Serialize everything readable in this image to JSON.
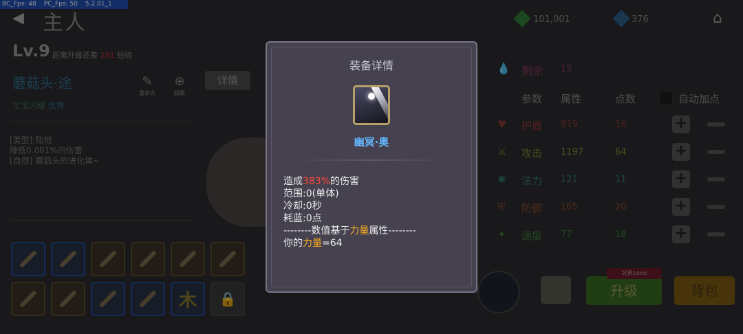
{
  "debug": {
    "bc_fps": "BC_Fps: 48",
    "pc_fps": "PC_Fps: 50",
    "version": "5.2.01_1"
  },
  "header": {
    "back_icon": "back-arrow-icon",
    "title": "主人"
  },
  "currency": {
    "gems_green": "101,001",
    "gems_blue": "376",
    "home_icon": "home-icon"
  },
  "pet": {
    "level": "Lv.9",
    "level_tip_prefix": "距离升级还差",
    "level_tip_value": "281",
    "level_tip_suffix": "经验",
    "name": "蘑菇头·途",
    "quality_label": "宝宝闪耀",
    "quality_value": "优秀",
    "rename_label": "重命名",
    "advance_label": "超级",
    "detail_button": "详情",
    "desc": [
      "[类型]:陆地",
      "降低0.001%的伤害",
      "[自然] 蘑菇头的进化体~"
    ]
  },
  "stats": {
    "remaining_label": "剩余",
    "remaining_value": "15",
    "col_param": "参数",
    "col_attr": "属性",
    "col_points": "点数",
    "auto_add": "自动加点",
    "rows": [
      {
        "label": "护盾",
        "value": "819",
        "points": "16",
        "color": "#8a3a3a",
        "icon": "heart-icon"
      },
      {
        "label": "攻击",
        "value": "1197",
        "points": "64",
        "color": "#8a8a3a",
        "icon": "sword-icon"
      },
      {
        "label": "法力",
        "value": "121",
        "points": "11",
        "color": "#2f7a6a",
        "icon": "magic-icon"
      },
      {
        "label": "防御",
        "value": "165",
        "points": "20",
        "color": "#8a4a2a",
        "icon": "shield-icon"
      },
      {
        "label": "速度",
        "value": "77",
        "points": "18",
        "color": "#3a7a3a",
        "icon": "wing-icon"
      }
    ]
  },
  "actions": {
    "upgrade": "升级",
    "upgrade_cost": "耗费1666",
    "bag": "背包"
  },
  "modal": {
    "title": "装备详情",
    "item_name": "幽冥·奥",
    "line1_a": "造成",
    "line1_b": "383%",
    "line1_c": "的伤害",
    "line2": "范围:0(单体)",
    "line3": "冷却:0秒",
    "line4": "耗蓝:0点",
    "line5_a": "--------数值基于",
    "line5_b": "力量",
    "line5_c": "属性--------",
    "line6_a": "你的",
    "line6_b": "力量",
    "line6_c": "=64"
  }
}
